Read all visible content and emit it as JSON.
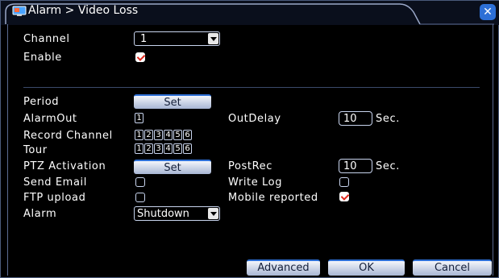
{
  "title": "Alarm > Video Loss",
  "close_glyph": "✕",
  "fields": {
    "channel_label": "Channel",
    "channel_value": "1",
    "enable_label": "Enable",
    "enable_checked": true,
    "period_label": "Period",
    "period_button": "Set",
    "alarmout_label": "AlarmOut",
    "alarmout_channels": [
      "1"
    ],
    "outdelay_label": "OutDelay",
    "outdelay_value": "10",
    "outdelay_unit": "Sec.",
    "record_channel_label": "Record Channel",
    "record_channels": [
      "1",
      "2",
      "3",
      "4",
      "5",
      "6"
    ],
    "tour_label": "Tour",
    "tour_channels": [
      "1",
      "2",
      "3",
      "4",
      "5",
      "6"
    ],
    "ptz_label": "PTZ Activation",
    "ptz_button": "Set",
    "postrec_label": "PostRec",
    "postrec_value": "10",
    "postrec_unit": "Sec.",
    "send_email_label": "Send Email",
    "send_email_checked": false,
    "write_log_label": "Write Log",
    "write_log_checked": false,
    "ftp_label": "FTP upload",
    "ftp_checked": false,
    "mobile_label": "Mobile reported",
    "mobile_checked": true,
    "alarm_label": "Alarm",
    "alarm_value": "Shutdown"
  },
  "buttons": {
    "advanced": "Advanced",
    "ok": "OK",
    "cancel": "Cancel"
  },
  "colors": {
    "accent": "#2d6fd6",
    "check_mark": "#e0281d",
    "background": "#000000"
  },
  "icons": {
    "title": "camera-monitor-icon",
    "close": "close-icon"
  }
}
